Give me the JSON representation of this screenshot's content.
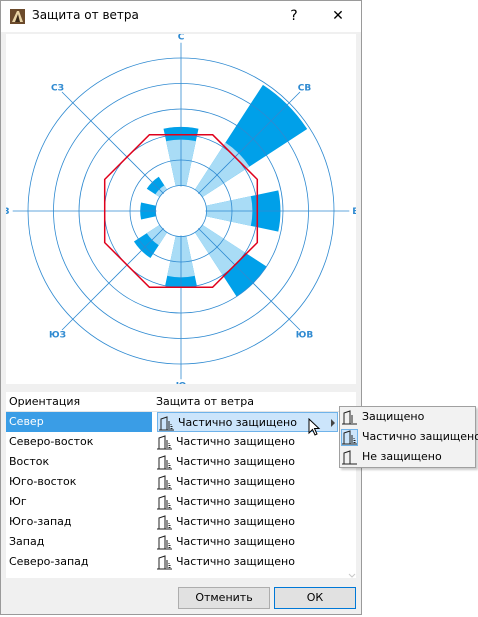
{
  "window": {
    "title": "Защита от ветра",
    "help_label": "?",
    "close_label": "✕"
  },
  "chart_data": {
    "type": "polar-bar",
    "directions": [
      {
        "label": "С",
        "light": 2.8,
        "dark": 3.3
      },
      {
        "label": "СВ",
        "light": 3.2,
        "dark": 5.9
      },
      {
        "label": "В",
        "light": 2.8,
        "dark": 3.9
      },
      {
        "label": "ЮВ",
        "light": 3.0,
        "dark": 4.0
      },
      {
        "label": "Ю",
        "light": 2.6,
        "dark": 3.0
      },
      {
        "label": "ЮЗ",
        "light": 1.6,
        "dark": 2.2
      },
      {
        "label": "З",
        "light": 1.0,
        "dark": 1.6
      },
      {
        "label": "СЗ",
        "light": 1.2,
        "dark": 1.6
      }
    ],
    "hole_radius": 1,
    "rings": [
      1,
      2,
      3,
      4,
      5,
      6
    ],
    "outline_radius": 3,
    "colors": {
      "light": "#a9dcf6",
      "dark": "#00a0e9",
      "outline": "#e0001b",
      "grid": "#2f8ad1"
    }
  },
  "grid": {
    "col_orientation": "Ориентация",
    "col_protection": "Защита от ветра",
    "rows": [
      {
        "orientation": "Север",
        "protection": "Частично защищено"
      },
      {
        "orientation": "Северо-восток",
        "protection": "Частично защищено"
      },
      {
        "orientation": "Восток",
        "protection": "Частично защищено"
      },
      {
        "orientation": "Юго-восток",
        "protection": "Частично защищено"
      },
      {
        "orientation": "Юг",
        "protection": "Частично защищено"
      },
      {
        "orientation": "Юго-запад",
        "protection": "Частично защищено"
      },
      {
        "orientation": "Запад",
        "protection": "Частично защищено"
      },
      {
        "orientation": "Северо-запад",
        "protection": "Частично защищено"
      }
    ]
  },
  "menu": {
    "items": [
      {
        "label": "Защищено",
        "icon": "protected-icon"
      },
      {
        "label": "Частично защищено",
        "icon": "partially-protected-icon"
      },
      {
        "label": "Не защищено",
        "icon": "unprotected-icon"
      }
    ]
  },
  "buttons": {
    "cancel": "Отменить",
    "ok": "ОК"
  }
}
